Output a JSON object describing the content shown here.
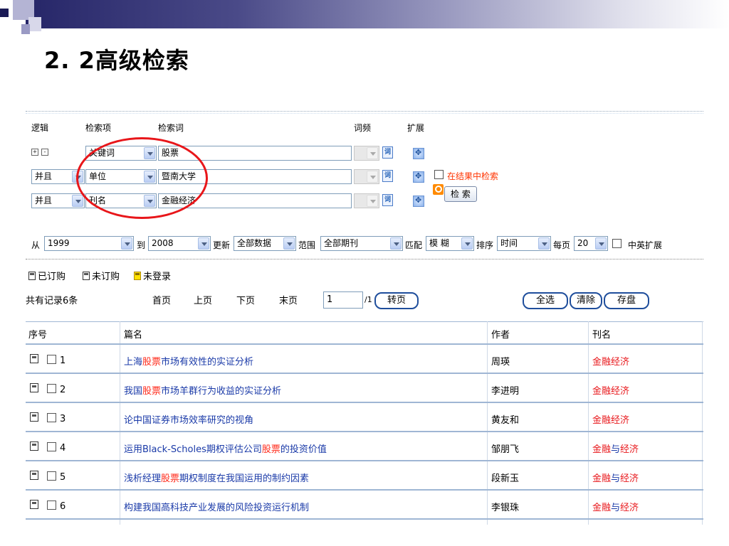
{
  "slide": {
    "title": "2. 2高级检索"
  },
  "form": {
    "headers": {
      "logic": "逻辑",
      "field": "检索项",
      "term": "检索词",
      "freq": "词频",
      "expand": "扩展"
    },
    "plus_minus": {
      "plus": "+",
      "minus": "-"
    },
    "rows": [
      {
        "logic": "",
        "field": "关键词",
        "term": "股票"
      },
      {
        "logic": "并且",
        "field": "单位",
        "term": "暨南大学"
      },
      {
        "logic": "并且",
        "field": "刊名",
        "term": "金融经济"
      }
    ],
    "dict_icon": "词",
    "search_in_results": "在结果中检索",
    "search_button": "检 索",
    "filters": {
      "from_label": "从",
      "from_value": "1999",
      "to_label": "到",
      "to_value": "2008",
      "update_label": "更新",
      "update_value": "全部数据",
      "range_label": "范围",
      "range_value": "全部期刊",
      "match_label": "匹配",
      "match_value": "模 糊",
      "sort_label": "排序",
      "sort_value": "时间",
      "perpage_label": "每页",
      "perpage_value": "20",
      "cn_en_expand": "中英扩展"
    }
  },
  "legend": {
    "subscribed": "已订购",
    "not_subscribed": "未订购",
    "not_logged_in": "未登录"
  },
  "pager": {
    "total": "共有记录6条",
    "first": "首页",
    "prev": "上页",
    "next": "下页",
    "last": "末页",
    "page_value": "1",
    "page_total": "/1",
    "goto": "转页",
    "select_all": "全选",
    "clear": "清除",
    "save": "存盘"
  },
  "table": {
    "headers": {
      "no": "序号",
      "title": "篇名",
      "author": "作者",
      "journal": "刊名"
    },
    "rows": [
      {
        "no": "1",
        "title": [
          "上海",
          "股票",
          "市场有效性的实证分析"
        ],
        "author": "周瑛",
        "journal": [
          "金融经济"
        ]
      },
      {
        "no": "2",
        "title": [
          "我国",
          "股票",
          "市场羊群行为收益的实证分析"
        ],
        "author": "李进明",
        "journal": [
          "金融经济"
        ]
      },
      {
        "no": "3",
        "title": [
          "论中国证券市场效率研究的视角",
          "",
          ""
        ],
        "author": "黄友和",
        "journal": [
          "金融经济"
        ]
      },
      {
        "no": "4",
        "title": [
          "运用Black-Scholes期权评估公司",
          "股票",
          "的投资价值"
        ],
        "author": "邹朋飞",
        "journal": [
          "金融",
          "与",
          "经济"
        ]
      },
      {
        "no": "5",
        "title": [
          "浅析经理",
          "股票",
          "期权制度在我国运用的制约因素"
        ],
        "author": "段新玉",
        "journal": [
          "金融",
          "与",
          "经济"
        ]
      },
      {
        "no": "6",
        "title": [
          "构建我国高科技产业发展的风险投资运行机制",
          "",
          ""
        ],
        "author": "李银珠",
        "journal": [
          "金融",
          "与",
          "经济"
        ]
      }
    ]
  },
  "colors": {
    "accent": "#1f4e9c",
    "highlight": "#ff2a1a",
    "link": "#1a3aa8"
  }
}
